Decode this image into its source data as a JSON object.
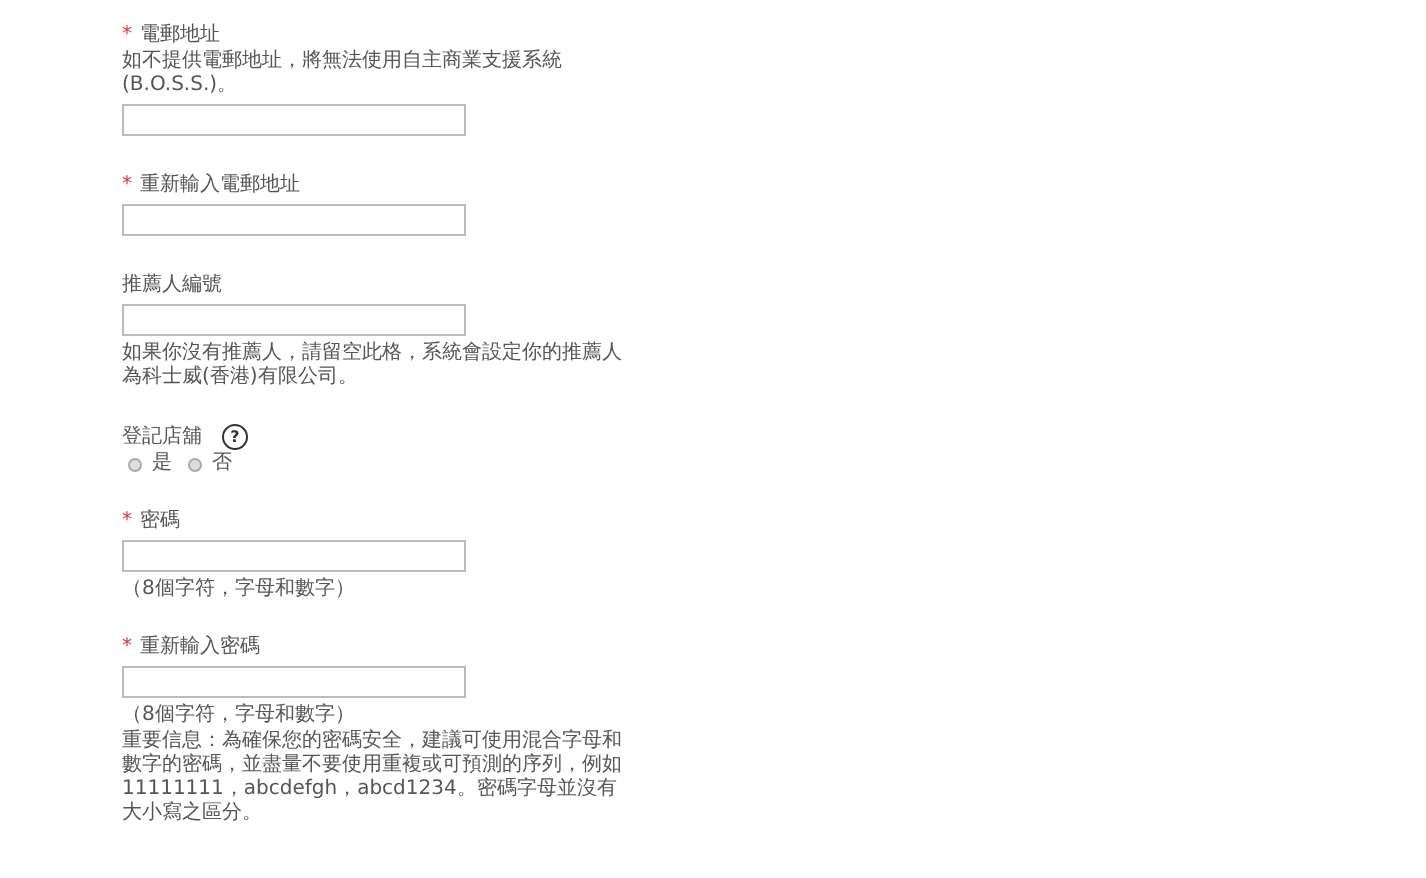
{
  "fields": [
    {
      "kind": "text",
      "required_mark": "*",
      "label": "電郵地址",
      "help_above": "如不提供電郵地址，將無法使用自主商業支援系統(B.O.S.S.)。"
    },
    {
      "kind": "text",
      "required_mark": "*",
      "label": "重新輸入電郵地址"
    },
    {
      "kind": "text",
      "label": "推薦人編號",
      "notes": [
        "如果你沒有推薦人，請留空此格，系統會設定你的推薦人為科士威(香港)有限公司。"
      ]
    },
    {
      "kind": "radio",
      "label": "登記店舖",
      "help": "?",
      "options": [
        {
          "label": "是",
          "selected": false
        },
        {
          "label": "否",
          "selected": false
        }
      ]
    },
    {
      "kind": "text",
      "required_mark": "*",
      "label": "密碼",
      "notes": [
        "（8個字符，字母和數字）"
      ]
    },
    {
      "kind": "text",
      "required_mark": "*",
      "label": "重新輸入密碼",
      "notes": [
        "（8個字符，字母和數字）",
        "重要信息：為確保您的密碼安全，建議可使用混合字母和數字的密碼，並盡量不要使用重複或可預測的序列，例如 11111111，abcdefgh，abcd1234。密碼字母並沒有大小寫之區分。"
      ]
    }
  ]
}
